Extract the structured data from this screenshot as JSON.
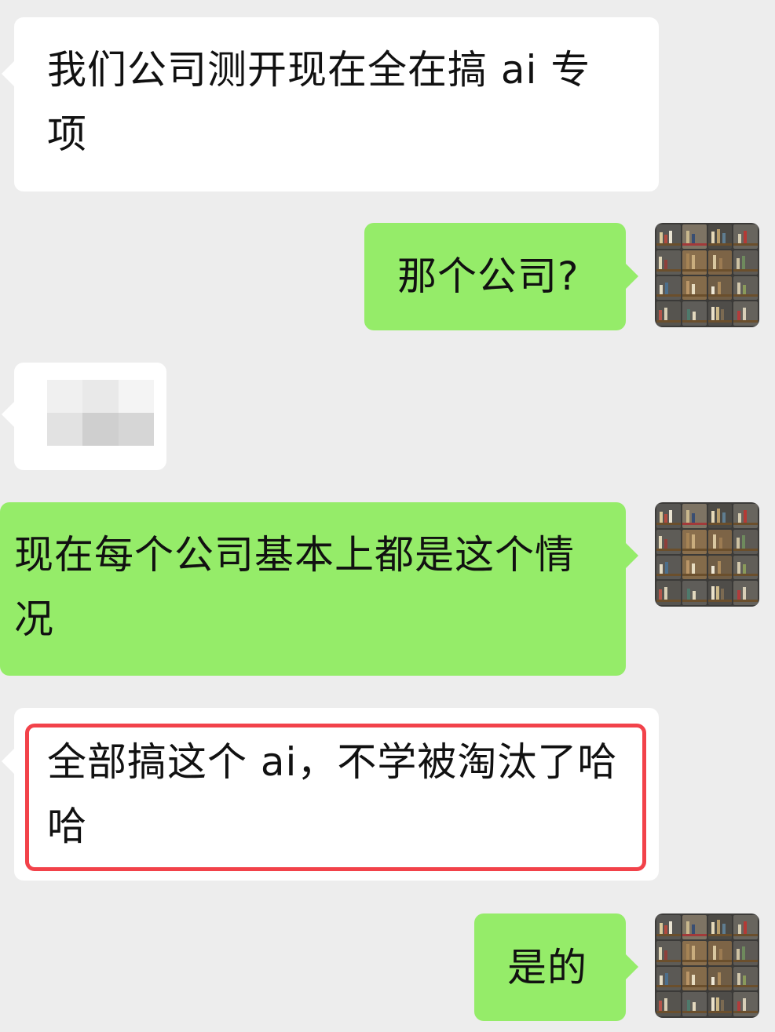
{
  "chat": {
    "messages": [
      {
        "sender": "other",
        "text": "我们公司测开现在全在搞 ai 专项"
      },
      {
        "sender": "me",
        "text": "那个公司?"
      },
      {
        "sender": "other",
        "text": ""
      },
      {
        "sender": "me",
        "text": "现在每个公司基本上都是这个情况"
      },
      {
        "sender": "other",
        "text": "全部搞这个 ai，不学被淘汰了哈哈"
      },
      {
        "sender": "me",
        "text": "是的"
      }
    ]
  },
  "colors": {
    "background": "#ededed",
    "incoming_bubble": "#ffffff",
    "outgoing_bubble": "#95ec69",
    "highlight_border": "#f2424a"
  },
  "icons": {
    "avatar": "bookshelf-avatar-icon",
    "blurred": "blurred-content"
  }
}
